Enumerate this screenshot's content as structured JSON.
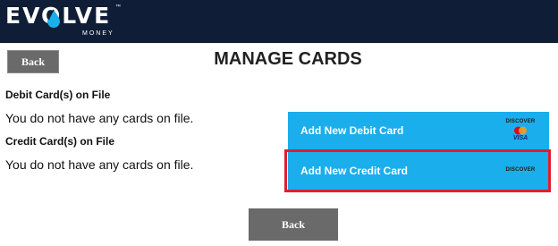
{
  "header": {
    "logo_word": "EVOLVE",
    "logo_sub": "MONEY",
    "logo_tm": "™",
    "bg_color": "#0f1e36"
  },
  "page": {
    "title": "MANAGE CARDS",
    "back_label_top": "Back",
    "back_label_bottom": "Back"
  },
  "debit": {
    "heading": "Debit Card(s) on File",
    "empty_text": "You do not have any cards on file.",
    "add_label": "Add New Debit Card"
  },
  "credit": {
    "heading": "Credit Card(s) on File",
    "empty_text": "You do not have any cards on file.",
    "add_label": "Add New Credit Card"
  },
  "card_logos": {
    "discover": "DISCOVER",
    "visa": "VISA"
  },
  "colors": {
    "accent": "#1aaeec",
    "highlight": "#e01e2a",
    "back_button": "#6a6a6a"
  }
}
